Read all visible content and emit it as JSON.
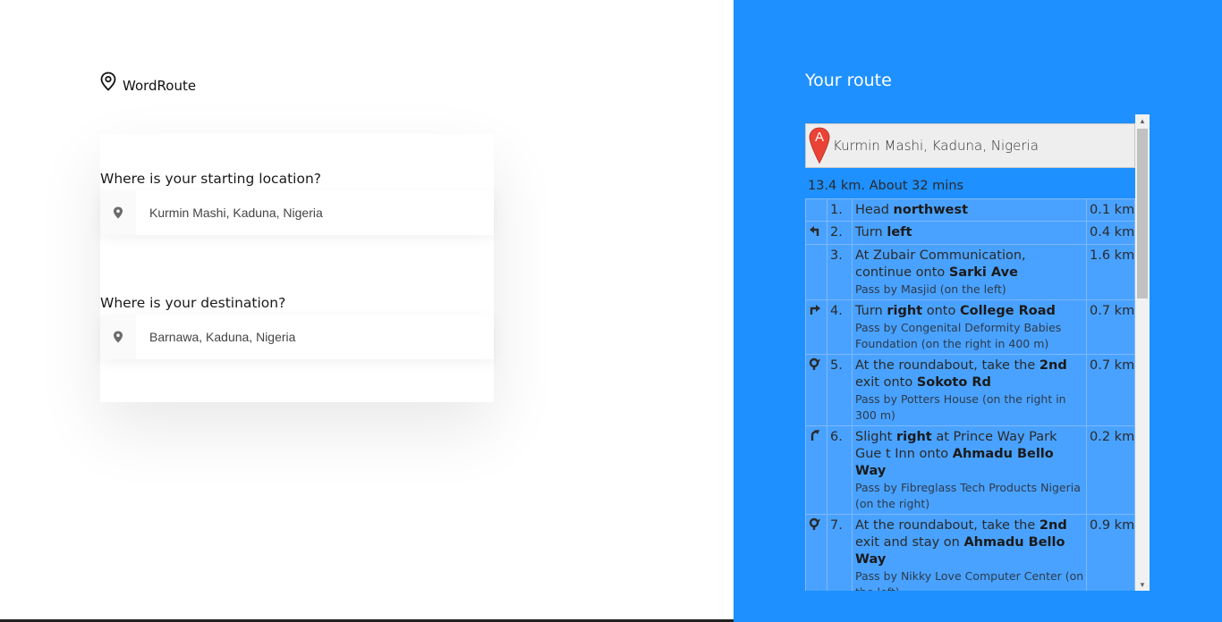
{
  "app": {
    "logo_text": "WordRoute"
  },
  "form": {
    "start_label": "Where is your starting location?",
    "start_value": "Kurmin Mashi, Kaduna, Nigeria",
    "dest_label": "Where is your destination?",
    "dest_value": "Barnawa, Kaduna, Nigeria"
  },
  "route": {
    "title": "Your route",
    "start_marker": "A",
    "start_address": "Kurmin Mashi, Kaduna, Nigeria",
    "summary": "13.4 km. About 32 mins",
    "steps": [
      {
        "num": "1.",
        "icon": "none",
        "pre": "Head ",
        "b1": "northwest",
        "mid": "",
        "b2": "",
        "sub": "",
        "dist": "0.1 km"
      },
      {
        "num": "2.",
        "icon": "turn-left-icon",
        "pre": "Turn ",
        "b1": "left",
        "mid": "",
        "b2": "",
        "sub": "",
        "dist": "0.4 km"
      },
      {
        "num": "3.",
        "icon": "none",
        "pre": "At Zubair Communication, continue onto ",
        "b1": "Sarki Ave",
        "mid": "",
        "b2": "",
        "sub": "Pass by Masjid (on the left)",
        "dist": "1.6 km"
      },
      {
        "num": "4.",
        "icon": "turn-right-icon",
        "pre": "Turn ",
        "b1": "right",
        "mid": " onto ",
        "b2": "College Road",
        "sub": "Pass by Congenital Deformity Babies Foundation (on the right in 400 m)",
        "dist": "0.7 km"
      },
      {
        "num": "5.",
        "icon": "roundabout-icon",
        "pre": "At the roundabout, take the ",
        "b1": "2nd",
        "mid": " exit onto ",
        "b2": "Sokoto Rd",
        "sub": "Pass by Potters House (on the right in 300 m)",
        "dist": "0.7 km"
      },
      {
        "num": "6.",
        "icon": "slight-right-icon",
        "pre": "Slight ",
        "b1": "right",
        "mid": " at Prince Way Park Gue t Inn onto ",
        "b2": "Ahmadu Bello Way",
        "sub": "Pass by Fibreglass Tech Products Nigeria (on the right)",
        "dist": "0.2 km"
      },
      {
        "num": "7.",
        "icon": "roundabout-icon",
        "pre": "At the roundabout, take the ",
        "b1": "2nd",
        "mid": " exit and stay on ",
        "b2": "Ahmadu Bello Way",
        "sub": "Pass by Nikky Love Computer Center (on the left)",
        "dist": "0.9 km"
      }
    ]
  },
  "colors": {
    "accent": "#1e90ff",
    "step_bg": "#49a2ff",
    "marker": "#ea4335"
  }
}
